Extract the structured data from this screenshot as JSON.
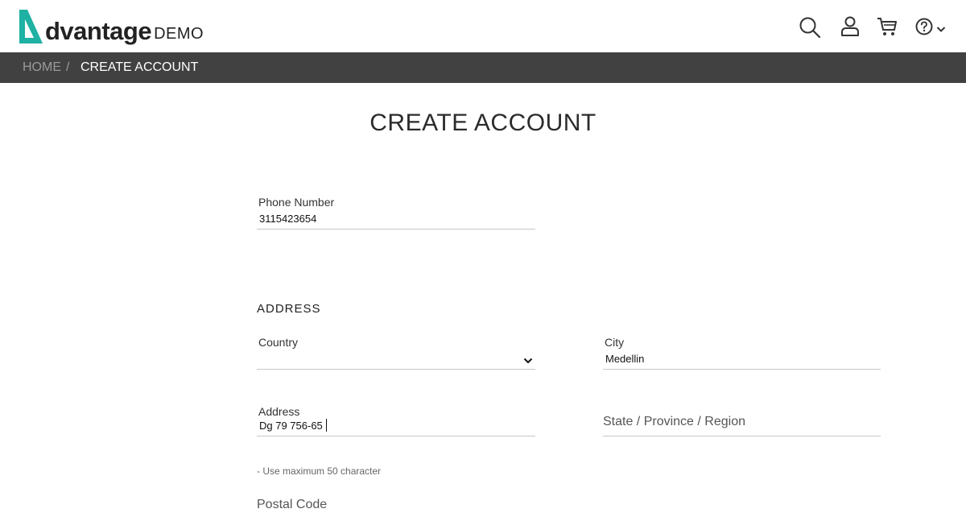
{
  "header": {
    "logo_text": "dvantage",
    "logo_suffix": "DEMO",
    "icons": [
      "search-icon",
      "user-icon",
      "cart-icon",
      "help-icon",
      "chevron-down-icon"
    ],
    "accent_color": "#1fb1a3"
  },
  "breadcrumb": {
    "home": "HOME",
    "separator": "/",
    "current": "CREATE ACCOUNT"
  },
  "page": {
    "title": "CREATE ACCOUNT"
  },
  "form": {
    "phone": {
      "label": "Phone Number",
      "value": "3115423654"
    },
    "address_section": {
      "title": "ADDRESS"
    },
    "country": {
      "label": "Country",
      "value": ""
    },
    "city": {
      "label": "City",
      "value": "Medellin"
    },
    "address": {
      "label": "Address",
      "value": "Dg 79 756-65",
      "hint": "- Use maximum 50 character"
    },
    "state": {
      "placeholder": "State / Province / Region"
    },
    "postal_code": {
      "placeholder": "Postal Code"
    }
  }
}
